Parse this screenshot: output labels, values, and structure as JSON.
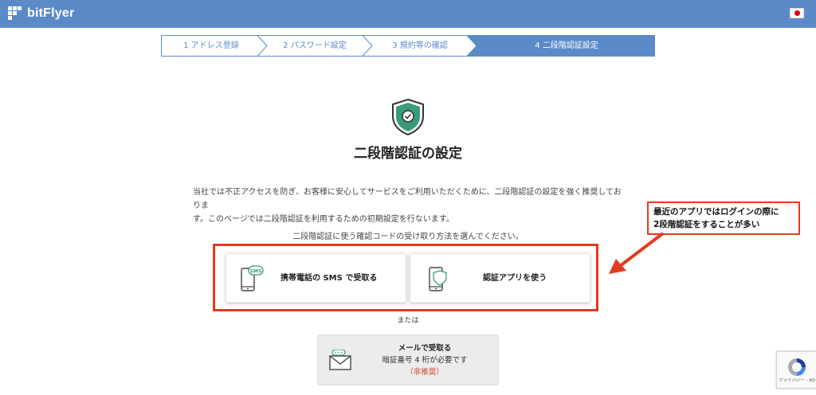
{
  "header": {
    "logo_text": "bitFlyer",
    "language_flag": "japan-flag-icon"
  },
  "stepper": {
    "steps": [
      {
        "label": "1 アドレス登録",
        "active": false
      },
      {
        "label": "2 パスワード設定",
        "active": false
      },
      {
        "label": "3 規約等の確認",
        "active": false
      },
      {
        "label": "4 二段階認証設定",
        "active": true
      }
    ]
  },
  "main": {
    "icon": "shield-check-icon",
    "title": "二段階認証の設定",
    "description_line1": "当社では不正アクセスを防ぎ、お客様に安心してサービスをご利用いただくために、二段階認証の設定を強く推奨しておりま",
    "description_line2": "す。このページでは二段階認証を利用するための初期設定を行ないます。",
    "choose_text": "二段階認証に使う確認コードの受け取り方法を選んでください。",
    "options": [
      {
        "label": "携帯電話の SMS で受取る",
        "icon": "phone-sms-icon",
        "badge": "SMS"
      },
      {
        "label": "認証アプリを使う",
        "icon": "phone-shield-icon"
      }
    ],
    "or_text": "または",
    "email_option": {
      "title": "メールで受取る",
      "subtitle": "暗証番号 4 桁が必要です",
      "warning": "（非推奨）",
      "icon": "envelope-icon"
    }
  },
  "annotation": {
    "line1": "最近のアプリではログインの際に",
    "line2": "2段階認証をすることが多い"
  },
  "recaptcha": {
    "text": "プライバシー - 利用規約"
  },
  "colors": {
    "header_bg": "#5b8ac9",
    "accent_red": "#e43b1f",
    "shield_green": "#3a9b7a"
  }
}
